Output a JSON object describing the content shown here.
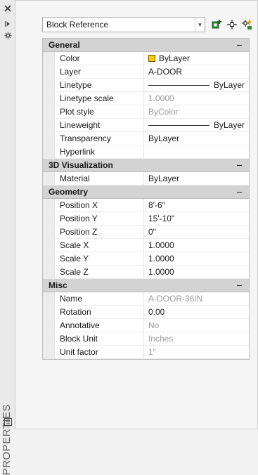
{
  "palette": {
    "title": "PROPERTIES",
    "icons": [
      "close-icon",
      "auto-hide-icon",
      "palette-settings-icon",
      "palette-menu-icon"
    ]
  },
  "selector": {
    "value": "Block Reference"
  },
  "toolbar": {
    "icons": [
      "toggle-pickadd-icon",
      "select-objects-icon",
      "quick-select-icon"
    ]
  },
  "categories": [
    {
      "name": "General",
      "properties": [
        {
          "label": "Color",
          "value": "ByLayer",
          "swatch": "#ffcc00"
        },
        {
          "label": "Layer",
          "value": "A-DOOR"
        },
        {
          "label": "Linetype",
          "value": "ByLayer",
          "line": true
        },
        {
          "label": "Linetype scale",
          "value": "1.0000",
          "dim": true
        },
        {
          "label": "Plot style",
          "value": "ByColor",
          "dim": true
        },
        {
          "label": "Lineweight",
          "value": "ByLayer",
          "line": true
        },
        {
          "label": "Transparency",
          "value": "ByLayer"
        },
        {
          "label": "Hyperlink",
          "value": ""
        }
      ]
    },
    {
      "name": "3D Visualization",
      "properties": [
        {
          "label": "Material",
          "value": "ByLayer"
        }
      ]
    },
    {
      "name": "Geometry",
      "properties": [
        {
          "label": "Position X",
          "value": "8'-6\""
        },
        {
          "label": "Position Y",
          "value": "15'-10\""
        },
        {
          "label": "Position Z",
          "value": "0\""
        },
        {
          "label": "Scale X",
          "value": "1.0000"
        },
        {
          "label": "Scale Y",
          "value": "1.0000"
        },
        {
          "label": "Scale Z",
          "value": "1.0000"
        }
      ]
    },
    {
      "name": "Misc",
      "properties": [
        {
          "label": "Name",
          "value": "A-DOOR-36IN",
          "dim": true
        },
        {
          "label": "Rotation",
          "value": "0.00"
        },
        {
          "label": "Annotative",
          "value": "No",
          "dim": true
        },
        {
          "label": "Block Unit",
          "value": "Inches",
          "dim": true
        },
        {
          "label": "Unit factor",
          "value": "1\"",
          "dim": true
        }
      ]
    }
  ],
  "colors": {
    "category_bg": "#d3d3d3",
    "dim_text": "#9a9a9a",
    "swatch_yellow": "#ffcc00"
  }
}
